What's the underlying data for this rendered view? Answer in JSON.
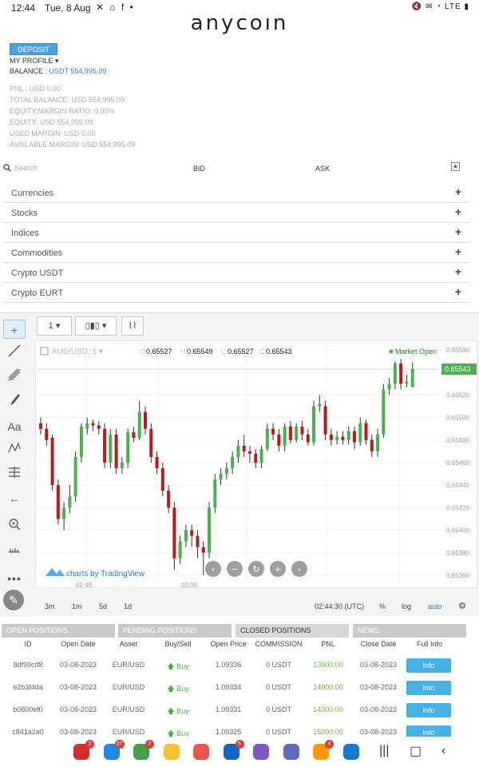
{
  "status_bar": {
    "time": "12:44",
    "date": "Tue, 8 Aug",
    "icons": "✕ ⌂ f •",
    "right": "🔇 ✉ ◔ LTE ▮"
  },
  "app": {
    "logo": "anycoın"
  },
  "account": {
    "deposit_label": "DEPOSIT",
    "profile_label": "MY PROFILE",
    "balance_label": "BALANCE :",
    "balance_value": "USDT 554,995.09",
    "metrics": [
      "PNL : USD 0.00",
      "TOTAL BALANCE: USD 554,995.09",
      "EQUITY:MARGIN RATIO: 0.00%",
      "EQUITY: USD 554,995.09",
      "USED MARGIN: USD 0.00",
      "AVAILABLE MARGIN: USD 554,995.09"
    ]
  },
  "search": {
    "placeholder": "Search",
    "bid_label": "BID",
    "ask_label": "ASK"
  },
  "categories": [
    "Currencies",
    "Stocks",
    "Indices",
    "Commodities",
    "Crypto USDT",
    "Crypto EURT"
  ],
  "chart_toolbar": {
    "interval": "1"
  },
  "chart_data": {
    "type": "candlestick",
    "symbol": "AUD/USD, 1",
    "ohlc": {
      "O": "0.65527",
      "H": "0.65549",
      "L": "0.65527",
      "C": "0.65543"
    },
    "ohlc_labels": {
      "O": "O",
      "H": "H",
      "L": "L",
      "C": "C"
    },
    "status": "Market Open",
    "current_price": "0.65543",
    "y_ticks": [
      "0.65560",
      "0.65540",
      "0.65520",
      "0.65500",
      "0.65480",
      "0.65460",
      "0.65440",
      "0.65420",
      "0.65400",
      "0.65380",
      "0.65360"
    ],
    "ylim": [
      0.65355,
      0.65565
    ],
    "x_ticks": [
      "01:40",
      "02:00"
    ],
    "watermark": "charts by TradingView",
    "candles": [
      [
        0.65495,
        0.6549,
        0.655,
        0.65485
      ],
      [
        0.6549,
        0.6548,
        0.65495,
        0.65475
      ],
      [
        0.65482,
        0.6544,
        0.65485,
        0.65435
      ],
      [
        0.6544,
        0.6541,
        0.65445,
        0.65405
      ],
      [
        0.6541,
        0.6542,
        0.65425,
        0.654
      ],
      [
        0.6542,
        0.6543,
        0.6544,
        0.65415
      ],
      [
        0.6543,
        0.65465,
        0.6547,
        0.65425
      ],
      [
        0.65465,
        0.65492,
        0.65495,
        0.6546
      ],
      [
        0.6549,
        0.65495,
        0.655,
        0.65485
      ],
      [
        0.65495,
        0.65493,
        0.65498,
        0.65488
      ],
      [
        0.65493,
        0.6549,
        0.65497,
        0.65485
      ],
      [
        0.6549,
        0.6546,
        0.65495,
        0.65455
      ],
      [
        0.6546,
        0.65485,
        0.6549,
        0.65455
      ],
      [
        0.65485,
        0.65455,
        0.6549,
        0.6545
      ],
      [
        0.65455,
        0.6546,
        0.65465,
        0.6545
      ],
      [
        0.6546,
        0.65487,
        0.6549,
        0.65455
      ],
      [
        0.65487,
        0.65482,
        0.65492,
        0.65478
      ],
      [
        0.65482,
        0.65505,
        0.65515,
        0.6548
      ],
      [
        0.65505,
        0.6549,
        0.6551,
        0.65485
      ],
      [
        0.6549,
        0.65465,
        0.65495,
        0.6546
      ],
      [
        0.65465,
        0.65455,
        0.6547,
        0.6545
      ],
      [
        0.65455,
        0.65435,
        0.6546,
        0.6543
      ],
      [
        0.65435,
        0.6542,
        0.6544,
        0.65415
      ],
      [
        0.6542,
        0.65375,
        0.65425,
        0.65365
      ],
      [
        0.65375,
        0.6539,
        0.65395,
        0.6537
      ],
      [
        0.6539,
        0.654,
        0.65405,
        0.65385
      ],
      [
        0.654,
        0.65395,
        0.65405,
        0.65385
      ],
      [
        0.65395,
        0.65385,
        0.654,
        0.65375
      ],
      [
        0.65385,
        0.6538,
        0.6539,
        0.6536
      ],
      [
        0.6538,
        0.6542,
        0.65425,
        0.65375
      ],
      [
        0.6542,
        0.65445,
        0.6545,
        0.65415
      ],
      [
        0.65445,
        0.6545,
        0.65455,
        0.6544
      ],
      [
        0.6545,
        0.65455,
        0.6546,
        0.65445
      ],
      [
        0.65455,
        0.65465,
        0.6547,
        0.6545
      ],
      [
        0.65465,
        0.65475,
        0.6548,
        0.6546
      ],
      [
        0.65475,
        0.6547,
        0.65485,
        0.65465
      ],
      [
        0.6547,
        0.65468,
        0.65475,
        0.6546
      ],
      [
        0.65468,
        0.6546,
        0.65472,
        0.65455
      ],
      [
        0.6546,
        0.65472,
        0.65475,
        0.65455
      ],
      [
        0.65472,
        0.6549,
        0.65495,
        0.6547
      ],
      [
        0.6549,
        0.65485,
        0.65495,
        0.6548
      ],
      [
        0.65485,
        0.65475,
        0.6549,
        0.6547
      ],
      [
        0.65475,
        0.65492,
        0.65495,
        0.6547
      ],
      [
        0.65492,
        0.6548,
        0.65497,
        0.65477
      ],
      [
        0.6548,
        0.65492,
        0.65495,
        0.65478
      ],
      [
        0.65492,
        0.65485,
        0.65497,
        0.6548
      ],
      [
        0.65485,
        0.65478,
        0.6549,
        0.65475
      ],
      [
        0.65478,
        0.6551,
        0.65515,
        0.65475
      ],
      [
        0.6551,
        0.65512,
        0.6552,
        0.65505
      ],
      [
        0.6551,
        0.65485,
        0.65515,
        0.6548
      ],
      [
        0.65485,
        0.6548,
        0.6549,
        0.65475
      ],
      [
        0.6548,
        0.65483,
        0.65488,
        0.65476
      ],
      [
        0.65483,
        0.6548,
        0.65488,
        0.65476
      ],
      [
        0.6548,
        0.65488,
        0.65492,
        0.65476
      ],
      [
        0.65488,
        0.65478,
        0.65492,
        0.65472
      ],
      [
        0.65478,
        0.65495,
        0.655,
        0.65475
      ],
      [
        0.65495,
        0.6548,
        0.65498,
        0.65476
      ],
      [
        0.6548,
        0.6547,
        0.65485,
        0.65465
      ],
      [
        0.6547,
        0.65485,
        0.6549,
        0.65465
      ],
      [
        0.65485,
        0.65525,
        0.6553,
        0.65482
      ],
      [
        0.65525,
        0.6553,
        0.65535,
        0.6552
      ],
      [
        0.6553,
        0.65548,
        0.6555,
        0.65525
      ],
      [
        0.65548,
        0.6553,
        0.65552,
        0.65525
      ],
      [
        0.6553,
        0.65532,
        0.65538,
        0.65527
      ],
      [
        0.65527,
        0.65543,
        0.65549,
        0.65527
      ]
    ],
    "colors": {
      "up": "#4caf50",
      "down": "#b71c1c",
      "price_line": "#4caf50"
    }
  },
  "chart_controls": {
    "ranges": [
      "3m",
      "1m",
      "5d",
      "1d"
    ],
    "clock": "02:44:30 (UTC)",
    "pct": "%",
    "log": "log",
    "auto": "auto"
  },
  "tabs": [
    "OPEN POSITIONS",
    "PENDING POSITIONS",
    "CLOSED POSITIONS",
    "NEWS"
  ],
  "table": {
    "headers": [
      "ID",
      "Open Date",
      "Asset",
      "Buy/Sell",
      "Open Price",
      "COMMISSION",
      "PNL",
      "Close Date",
      "Full Info"
    ],
    "rows": [
      [
        "8df99cd8",
        "03-08-2023",
        "EUR/USD",
        "Buy",
        "1.09336",
        "0 USDT",
        "13800.00",
        "03-08-2023",
        "Info"
      ],
      [
        "e2b3f4da",
        "03-08-2023",
        "EUR/USD",
        "Buy",
        "1.09334",
        "0 USDT",
        "14000.00",
        "03-08-2023",
        "Info"
      ],
      [
        "b0800ef0",
        "03-08-2023",
        "EUR/USD",
        "Buy",
        "1.09331",
        "0 USDT",
        "14300.00",
        "03-08-2023",
        "Info"
      ],
      [
        "c841a2a0",
        "03-08-2023",
        "EUR/USD",
        "Buy",
        "1.09325",
        "0 USDT",
        "15000.00",
        "03-08-2023",
        "Info"
      ]
    ]
  },
  "navbar": {
    "apps": [
      {
        "name": "app-1",
        "color": "#d32f2f",
        "badge": "2"
      },
      {
        "name": "app-2",
        "color": "#1e88e5",
        "badge": "27"
      },
      {
        "name": "app-3",
        "color": "#43a047",
        "badge": "2"
      },
      {
        "name": "app-4",
        "color": "#fbc02d",
        "badge": ""
      },
      {
        "name": "app-5",
        "color": "#ef5350",
        "badge": ""
      },
      {
        "name": "app-6",
        "color": "#1565c0",
        "badge": "5"
      },
      {
        "name": "app-7",
        "color": "#7e57c2",
        "badge": ""
      },
      {
        "name": "app-8",
        "color": "#5c6bc0",
        "badge": ""
      },
      {
        "name": "app-9",
        "color": "#ff9800",
        "badge": "4"
      },
      {
        "name": "app-10",
        "color": "#1976d2",
        "badge": ""
      }
    ]
  }
}
